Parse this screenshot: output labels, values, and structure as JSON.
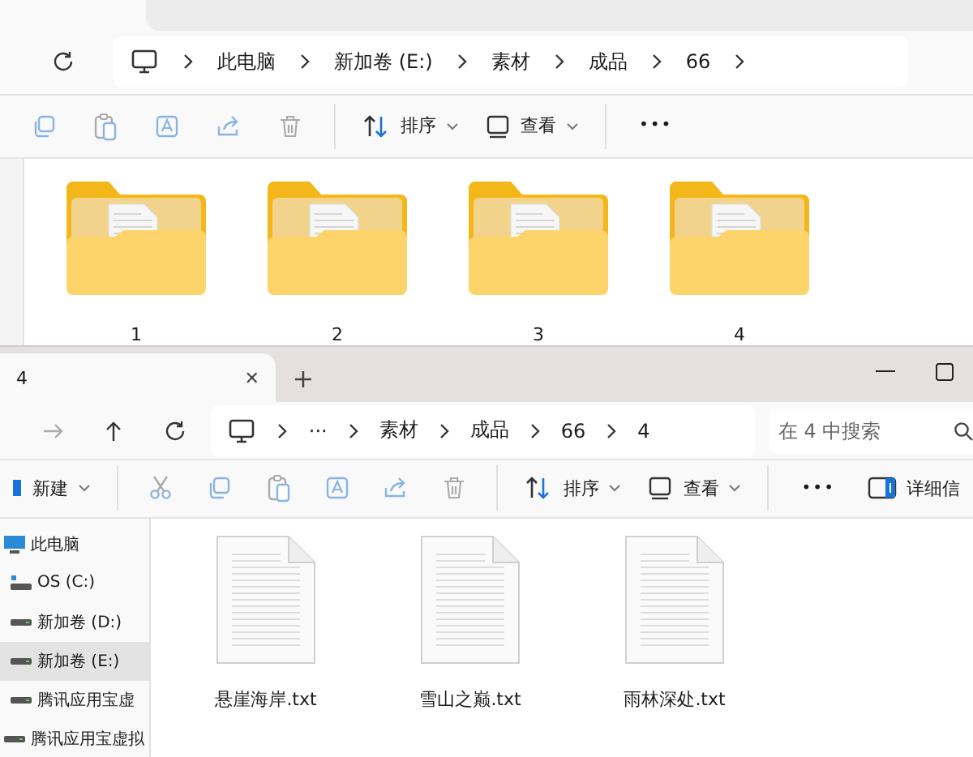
{
  "back_window": {
    "breadcrumbs": [
      "此电脑",
      "新加卷 (E:)",
      "素材",
      "成品",
      "66"
    ],
    "toolbar": {
      "sort": "排序",
      "view": "查看",
      "more": "•••"
    },
    "items": [
      {
        "name": "1"
      },
      {
        "name": "2"
      },
      {
        "name": "3"
      },
      {
        "name": "4"
      }
    ]
  },
  "front_window": {
    "tab": {
      "title": "4",
      "close": "✕",
      "new": "+"
    },
    "breadcrumbs": [
      "素材",
      "成品",
      "66",
      "4"
    ],
    "overflow": "···",
    "search": {
      "placeholder": "在 4 中搜索"
    },
    "toolbar": {
      "new": "新建",
      "sort": "排序",
      "view": "查看",
      "more": "•••",
      "details": "详细信"
    },
    "sidebar": {
      "items": [
        {
          "label": "此电脑",
          "kind": "pc",
          "selected": false,
          "children": [
            {
              "label": "OS (C:)",
              "kind": "os",
              "selected": false
            },
            {
              "label": "新加卷 (D:)",
              "kind": "drive",
              "selected": false
            },
            {
              "label": "新加卷 (E:)",
              "kind": "drive",
              "selected": true
            },
            {
              "label": "腾讯应用宝虚",
              "kind": "drive",
              "selected": false
            }
          ]
        },
        {
          "label": "腾讯应用宝虚拟",
          "kind": "drive",
          "selected": false
        }
      ]
    },
    "files": [
      {
        "name": "悬崖海岸.txt"
      },
      {
        "name": "雪山之巅.txt"
      },
      {
        "name": "雨林深处.txt"
      }
    ]
  }
}
